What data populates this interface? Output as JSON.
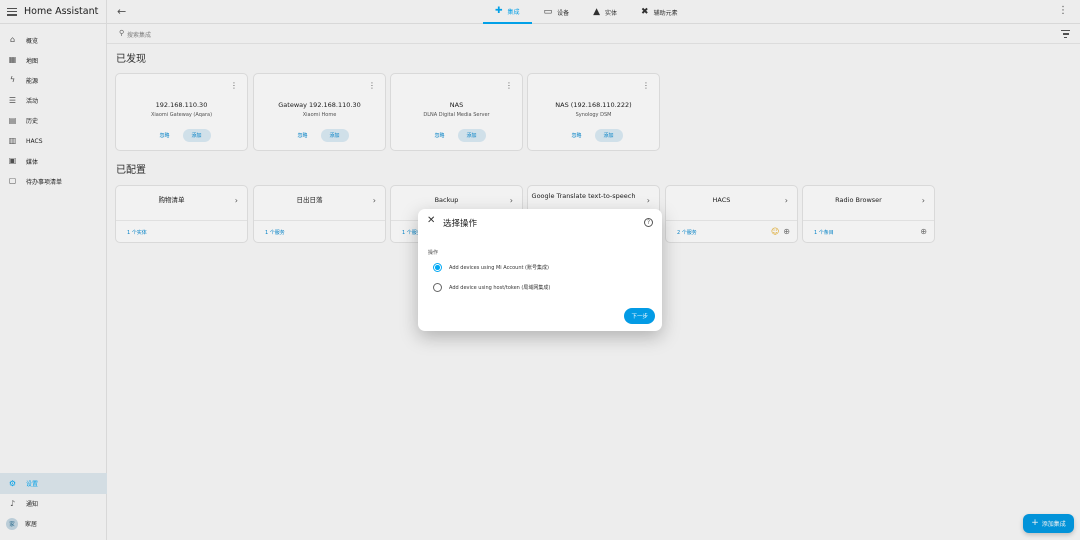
{
  "app": {
    "title": "Home Assistant"
  },
  "sidebar": {
    "items": [
      {
        "label": "概览",
        "icon": "home-icon"
      },
      {
        "label": "地图",
        "icon": "map-icon"
      },
      {
        "label": "能源",
        "icon": "lightning-icon"
      },
      {
        "label": "活动",
        "icon": "list-icon"
      },
      {
        "label": "历史",
        "icon": "chart-icon"
      },
      {
        "label": "HACS",
        "icon": "store-icon"
      },
      {
        "label": "媒体",
        "icon": "media-icon"
      },
      {
        "label": "待办事项清单",
        "icon": "clipboard-icon"
      }
    ],
    "bottom": [
      {
        "label": "设置",
        "icon": "gear-icon",
        "active": true
      },
      {
        "label": "通知",
        "icon": "bell-icon"
      },
      {
        "label": "家居",
        "avatar": "家"
      }
    ]
  },
  "tabs": [
    {
      "label": "集成",
      "icon": "puzzle-icon",
      "active": true
    },
    {
      "label": "设备",
      "icon": "devices-icon"
    },
    {
      "label": "实体",
      "icon": "shapes-icon"
    },
    {
      "label": "辅助元素",
      "icon": "tools-icon"
    }
  ],
  "search": {
    "placeholder": "搜索集成"
  },
  "sections": {
    "discovered": "已发现",
    "configured": "已配置"
  },
  "discovered": [
    {
      "title": "192.168.110.30",
      "subtitle": "Xiaomi Gateway (Aqara)",
      "ignore": "忽略",
      "add": "添加"
    },
    {
      "title": "Gateway 192.168.110.30",
      "subtitle": "Xiaomi Home",
      "ignore": "忽略",
      "add": "添加"
    },
    {
      "title": "NAS",
      "subtitle": "DLNA Digital Media Server",
      "ignore": "忽略",
      "add": "添加"
    },
    {
      "title": "NAS (192.168.110.222)",
      "subtitle": "Synology DSM",
      "ignore": "忽略",
      "add": "添加"
    }
  ],
  "configured": [
    {
      "name": "购物清单",
      "link": "1 个实体"
    },
    {
      "name": "日出日落",
      "link": "1 个服务"
    },
    {
      "name": "Backup",
      "link": "1 个服务"
    },
    {
      "name": "Google Translate text-to-speech",
      "link": ""
    },
    {
      "name": "HACS",
      "link": "2 个服务"
    },
    {
      "name": "Radio Browser",
      "link": "1 个条目"
    }
  ],
  "dialog": {
    "title": "选择操作",
    "label": "操作",
    "options": [
      {
        "label": "Add devices using Mi Account (账号集成)",
        "selected": true
      },
      {
        "label": "Add device using host/token (局域网集成)",
        "selected": false
      }
    ],
    "next": "下一步"
  },
  "fab": {
    "label": "添加集成"
  },
  "colors": {
    "accent": "#03a9f4",
    "button": "#039be5"
  }
}
